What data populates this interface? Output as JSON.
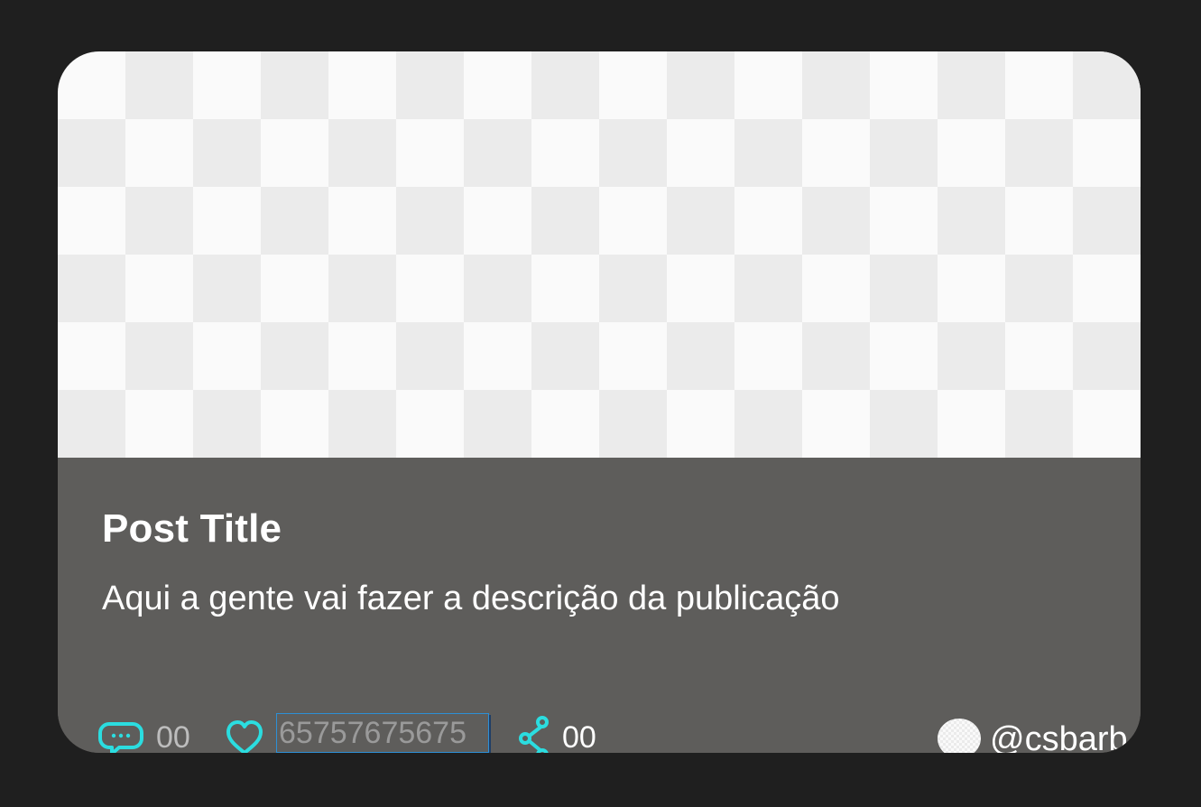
{
  "post": {
    "title": "Post Title",
    "description": "Aqui a gente vai fazer a descrição da publicação"
  },
  "stats": {
    "comments": "00",
    "likes": "65757675675",
    "shares": "00"
  },
  "author": {
    "handle": "@csbarb"
  },
  "icons": {
    "comment": "comment-bubble-icon",
    "like": "heart-icon",
    "share": "share-icon"
  },
  "colors": {
    "accent": "#2bdde0",
    "page_background": "#1f1f1f",
    "card_background": "#5e5d5b",
    "input_border": "#2d8fd6"
  }
}
